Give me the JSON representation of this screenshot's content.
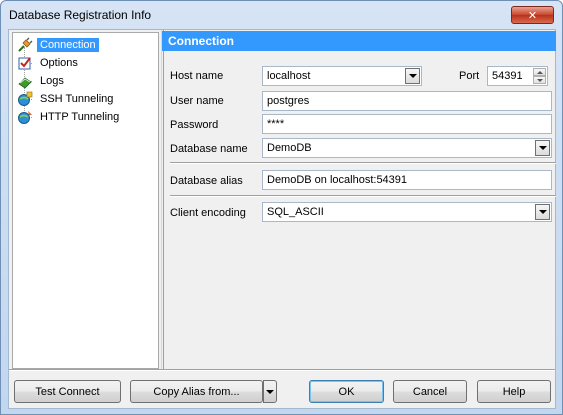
{
  "window": {
    "title": "Database Registration Info",
    "close_glyph": "✕"
  },
  "tree": {
    "items": [
      {
        "label": "Connection",
        "icon": "connection-plug-icon"
      },
      {
        "label": "Options",
        "icon": "options-checkbox-icon"
      },
      {
        "label": "Logs",
        "icon": "logs-book-icon"
      },
      {
        "label": "SSH Tunneling",
        "icon": "ssh-tunneling-icon"
      },
      {
        "label": "HTTP Tunneling",
        "icon": "http-tunneling-icon"
      }
    ],
    "selected": "Connection"
  },
  "section": {
    "title": "Connection"
  },
  "form": {
    "host_name": {
      "label": "Host name",
      "value": "localhost"
    },
    "port": {
      "label": "Port",
      "value": "54391"
    },
    "user_name": {
      "label": "User name",
      "value": "postgres"
    },
    "password": {
      "label": "Password",
      "value": "****"
    },
    "database_name": {
      "label": "Database name",
      "value": "DemoDB"
    },
    "database_alias": {
      "label": "Database alias",
      "value": "DemoDB on localhost:54391"
    },
    "client_encoding": {
      "label": "Client encoding",
      "value": "SQL_ASCII"
    }
  },
  "buttons": {
    "test_connect": "Test Connect",
    "copy_alias": "Copy Alias from...",
    "ok": "OK",
    "cancel": "Cancel",
    "help": "Help"
  }
}
